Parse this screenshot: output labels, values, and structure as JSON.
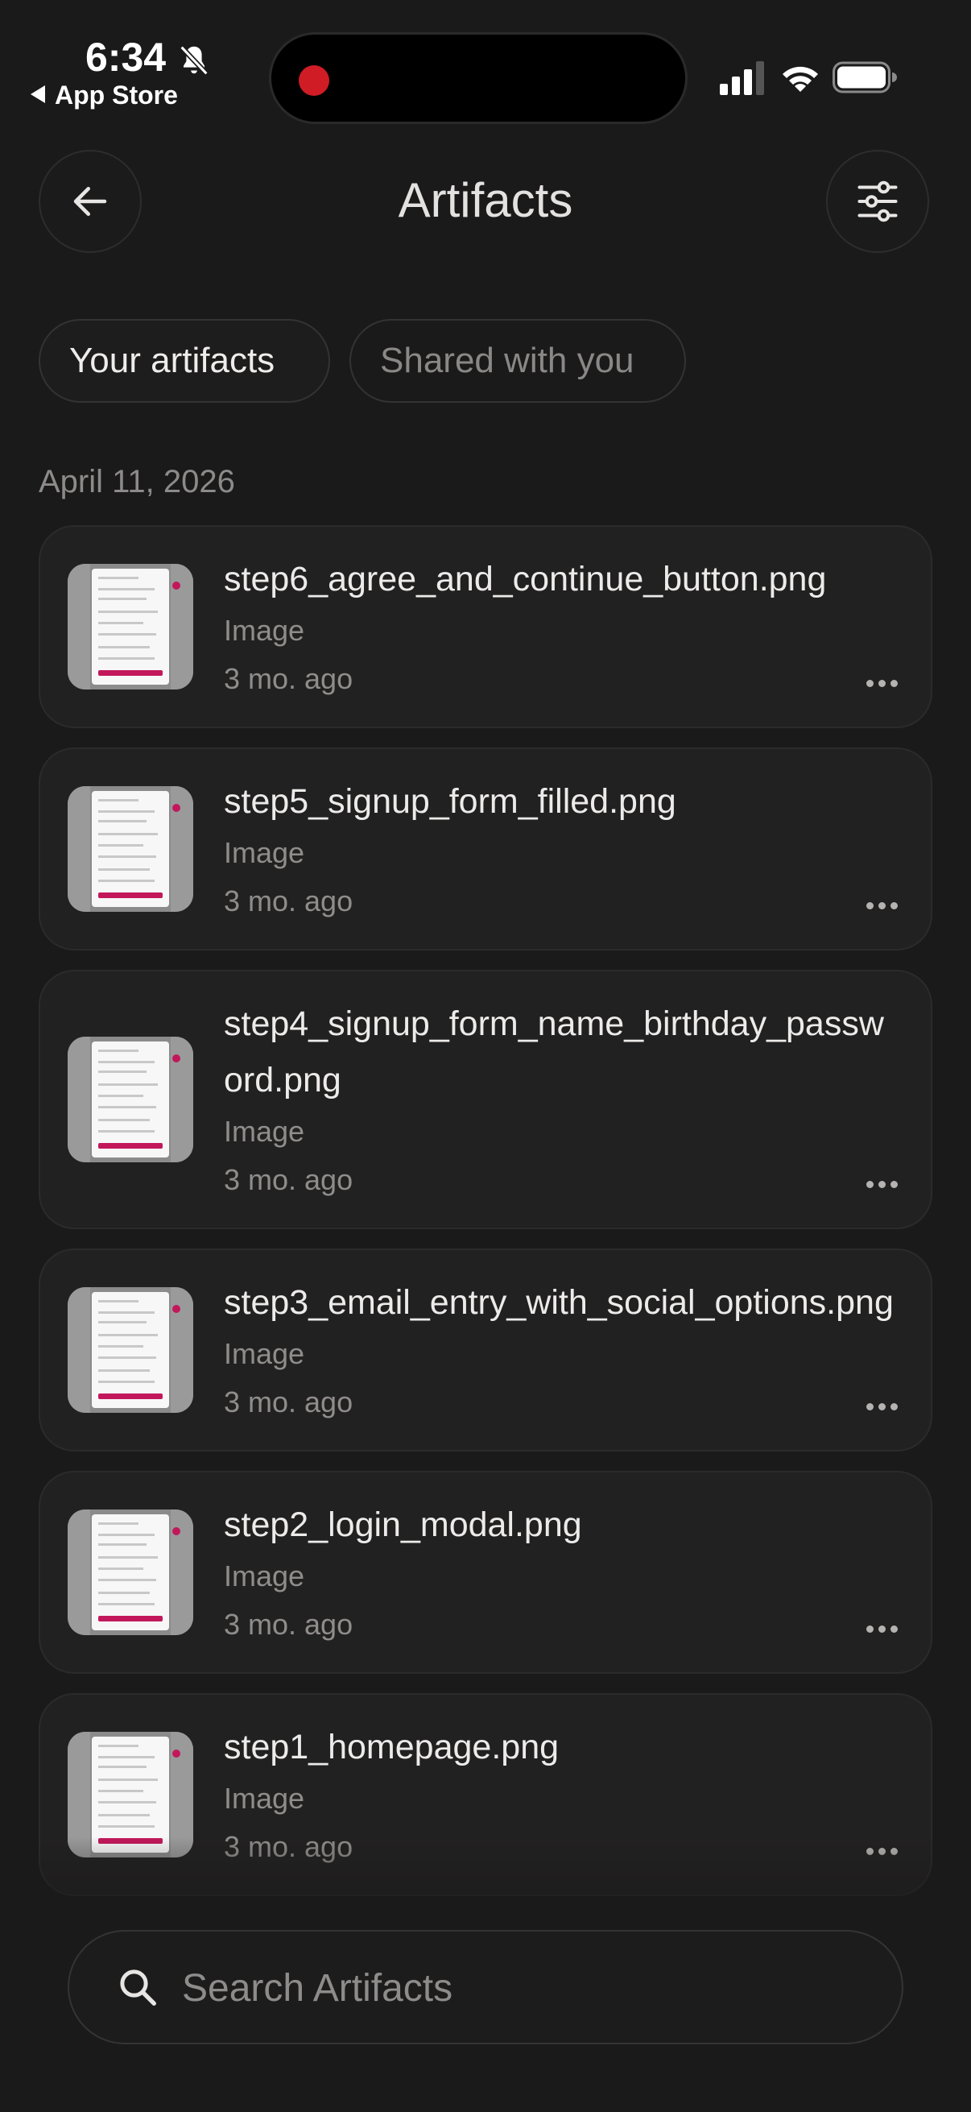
{
  "status_bar": {
    "time": "6:34",
    "back_app": "App Store",
    "icons": [
      "bell-slash-icon",
      "record-dot-icon",
      "cellular-signal-icon",
      "wifi-icon",
      "battery-icon"
    ]
  },
  "header": {
    "title": "Artifacts",
    "back_icon": "arrow-left-icon",
    "filter_icon": "sliders-icon"
  },
  "tabs": [
    {
      "label": "Your artifacts",
      "active": true
    },
    {
      "label": "Shared with you",
      "active": false
    }
  ],
  "section": {
    "date": "April 11, 2026"
  },
  "artifacts": [
    {
      "name": "step6_agree_and_continue_button.png",
      "type": "Image",
      "time": "3 mo. ago"
    },
    {
      "name": "step5_signup_form_filled.png",
      "type": "Image",
      "time": "3 mo. ago"
    },
    {
      "name": "step4_signup_form_name_birthday_password.png",
      "type": "Image",
      "time": "3 mo. ago"
    },
    {
      "name": "step3_email_entry_with_social_options.png",
      "type": "Image",
      "time": "3 mo. ago"
    },
    {
      "name": "step2_login_modal.png",
      "type": "Image",
      "time": "3 mo. ago"
    },
    {
      "name": "step1_homepage.png",
      "type": "Image",
      "time": "3 mo. ago"
    }
  ],
  "search": {
    "placeholder": "Search Artifacts",
    "icon": "search-icon"
  },
  "colors": {
    "background": "#1b1a1a",
    "card": "#222121",
    "accent": "#c2185b",
    "record": "#d01c25"
  }
}
